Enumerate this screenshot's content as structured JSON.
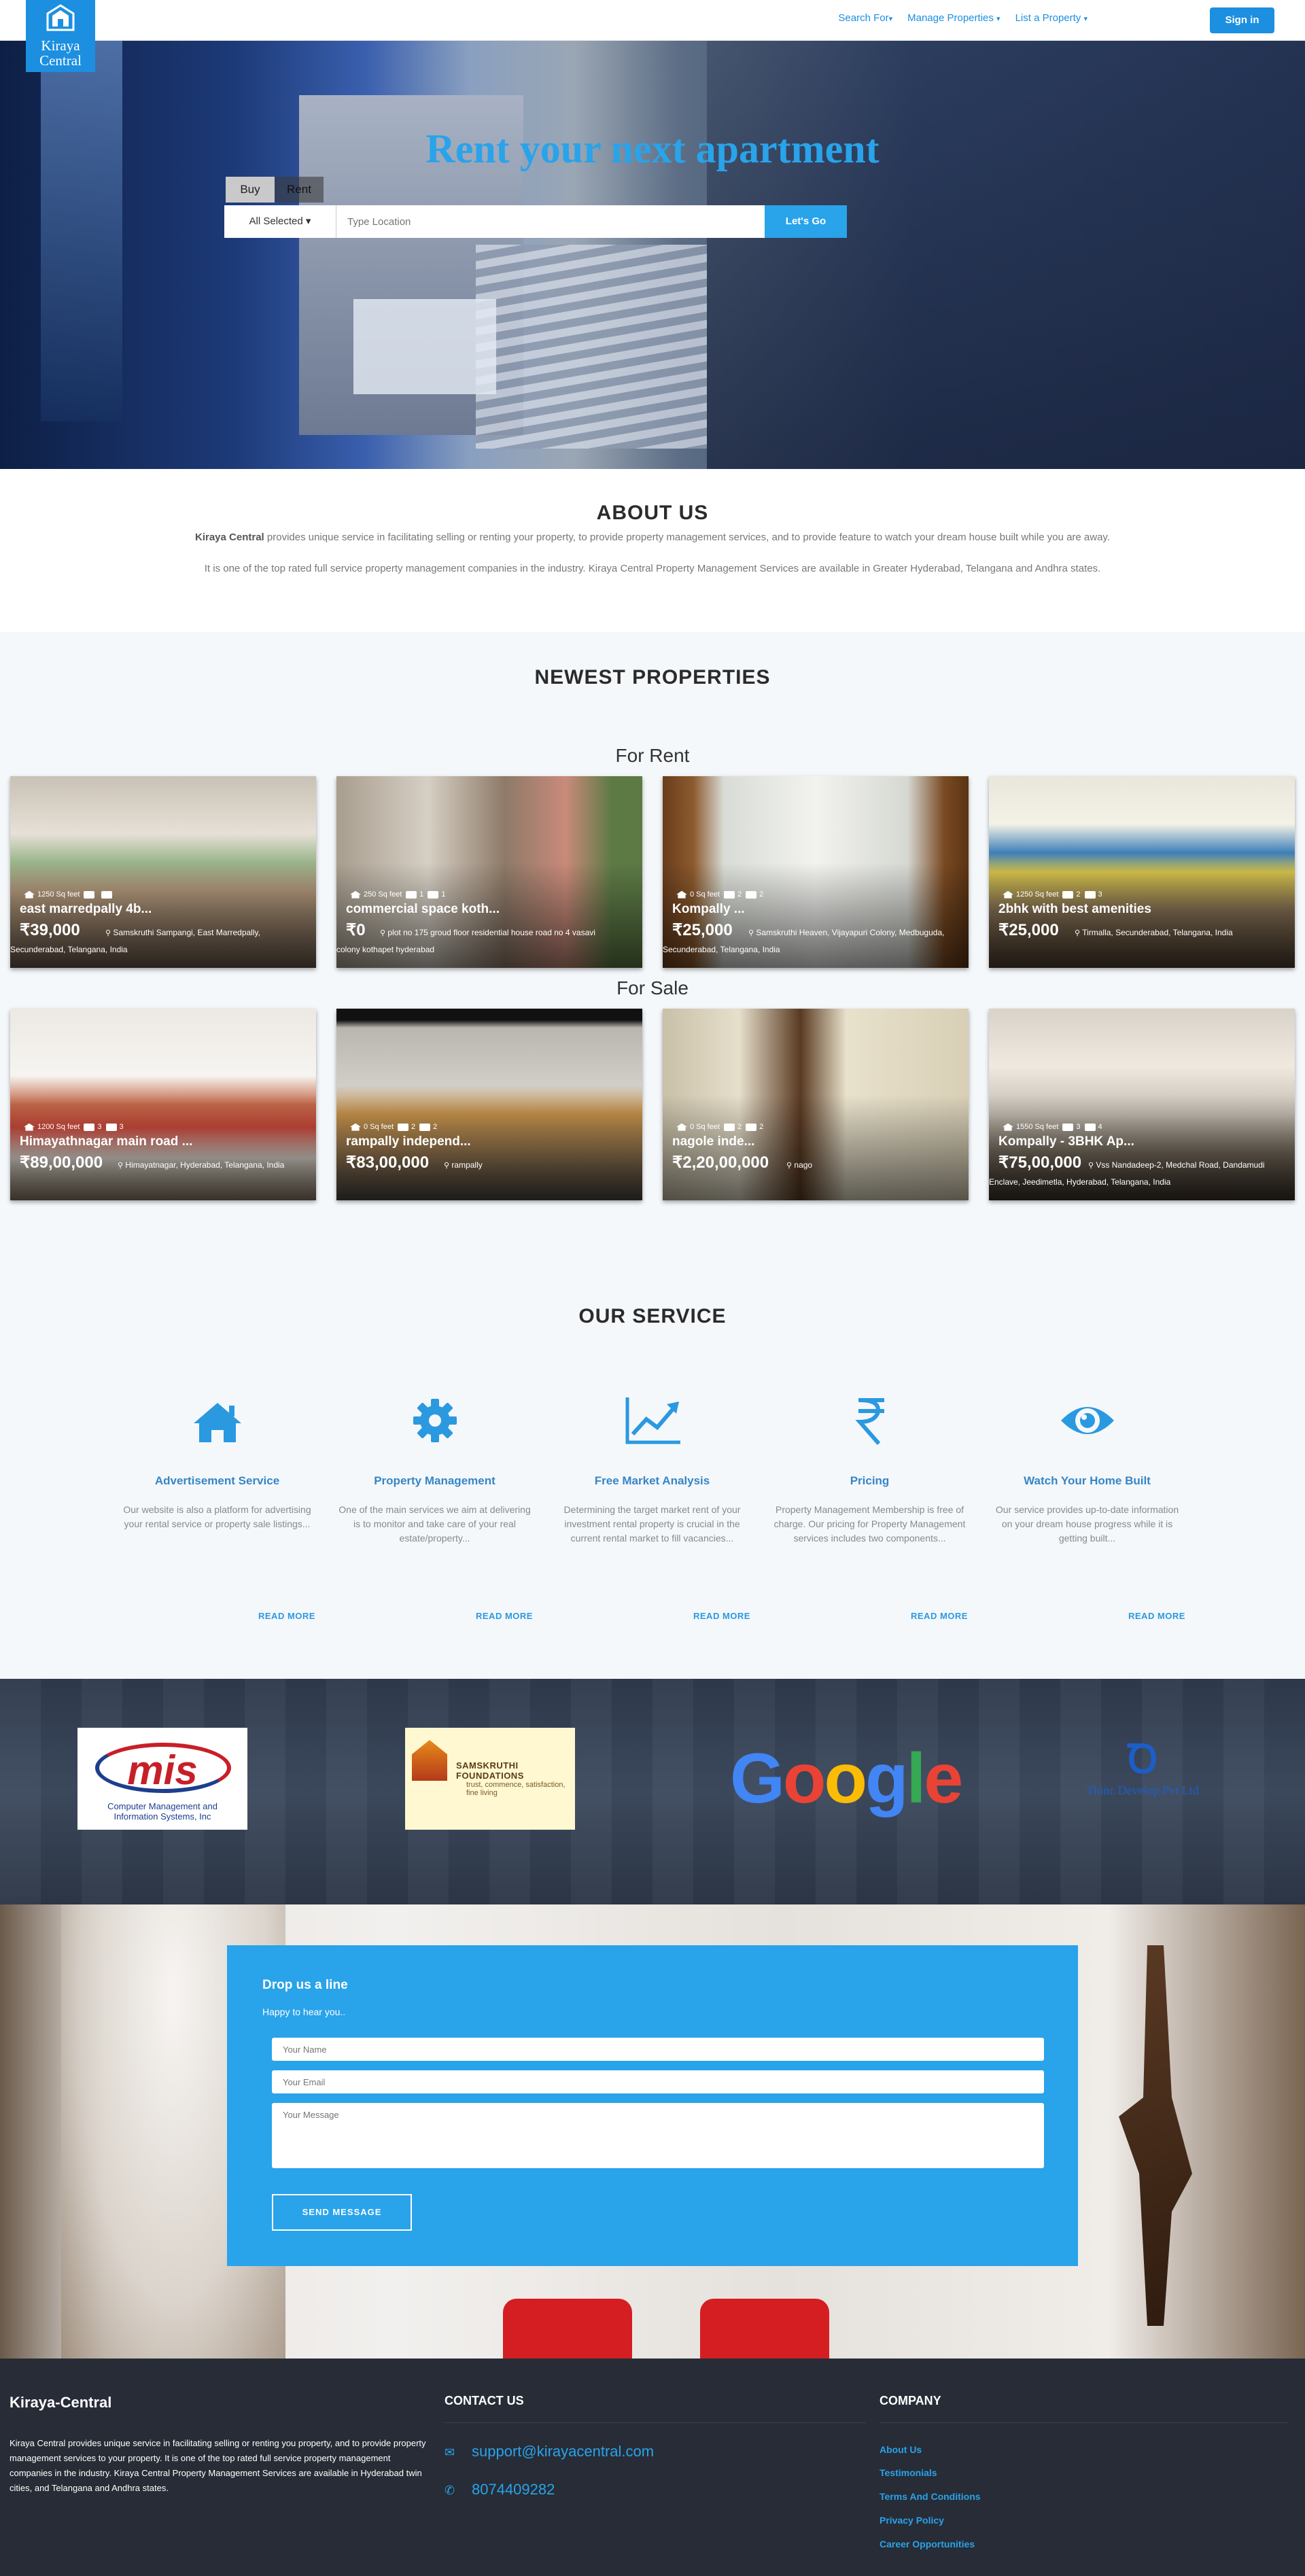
{
  "navbar": {
    "logo_text_line1": "Kiraya",
    "logo_text_line2": "Central",
    "links": [
      {
        "label": "Search For",
        "caret": "▾"
      },
      {
        "label": "Manage Properties",
        "caret": "▾"
      },
      {
        "label": "List a Property",
        "caret": "▾"
      }
    ],
    "signin_label": "Sign in"
  },
  "hero": {
    "title": "Rent your next apartment",
    "tab_buy": "Buy",
    "tab_rent": "Rent",
    "select_label": "All Selected",
    "select_caret": "▾",
    "search_placeholder": "Type Location",
    "search_button": "Let's Go"
  },
  "about": {
    "title": "ABOUT US",
    "brand": "Kiraya Central",
    "paragraph1_rest": " provides unique service in facilitating selling or renting your property, to provide property management services, and to provide feature to watch your dream house built while you are away.",
    "paragraph2": "It is one of the top rated full service property management companies in the industry. Kiraya Central Property Management Services are available in Greater Hyderabad, Telangana and Andhra states."
  },
  "newest": {
    "title": "NEWEST PROPERTIES",
    "rent_title": "For Rent",
    "sale_title": "For Sale",
    "rent": [
      {
        "area": "1250 Sq feet",
        "beds": "",
        "baths": "",
        "name": "east marredpally 4b...",
        "price": "₹39,000",
        "loc_line1": "Samskruthi Sampangi, East Marredpally,",
        "loc_line2": "Secunderabad, Telangana, India"
      },
      {
        "area": "250 Sq feet",
        "beds": "1",
        "baths": "1",
        "name": "commercial space koth...",
        "price": "₹0",
        "loc_line1": "plot no 175 groud floor residential house road no 4 vasavi",
        "loc_line2": "colony kothapet hyderabad"
      },
      {
        "area": "0 Sq feet",
        "beds": "2",
        "baths": "2",
        "name": "Kompally ...",
        "price": "₹25,000",
        "loc_line1": "Samskruthi Heaven, Vijayapuri Colony, Medbuguda,",
        "loc_line2": "Secunderabad, Telangana, India"
      },
      {
        "area": "1250 Sq feet",
        "beds": "2",
        "baths": "3",
        "name": "2bhk with best amenities",
        "price": "₹25,000",
        "loc_line1": "Tirmalla, Secunderabad, Telangana, India",
        "loc_line2": ""
      }
    ],
    "sale": [
      {
        "area": "1200 Sq feet",
        "beds": "3",
        "baths": "3",
        "name": "Himayathnagar main road ...",
        "price": "₹89,00,000",
        "loc_line1": "Himayatnagar, Hyderabad, Telangana, India",
        "loc_line2": ""
      },
      {
        "area": "0 Sq feet",
        "beds": "2",
        "baths": "2",
        "name": "rampally independ...",
        "price": "₹83,00,000",
        "loc_line1": "rampally",
        "loc_line2": ""
      },
      {
        "area": "0 Sq feet",
        "beds": "2",
        "baths": "2",
        "name": "nagole inde...",
        "price": "₹2,20,00,000",
        "loc_line1": "nago",
        "loc_line2": ""
      },
      {
        "area": "1550 Sq feet",
        "beds": "3",
        "baths": "4",
        "name": "Kompally - 3BHK Ap...",
        "price": "₹75,00,000",
        "loc_line1": "Vss Nandadeep-2, Medchal Road, Dandamudi",
        "loc_line2": "Enclave, Jeedimetla, Hyderabad, Telangana, India"
      }
    ]
  },
  "service": {
    "title": "OUR SERVICE",
    "items": [
      {
        "icon": "home-icon",
        "title": "Advertisement Service",
        "desc": "Our website is also a platform for advertising your rental service or property sale listings..."
      },
      {
        "icon": "gear-icon",
        "title": "Property Management",
        "desc": "One of the main services we aim at delivering is to monitor and take care of your real estate/property..."
      },
      {
        "icon": "chart-line-icon",
        "title": "Free Market Analysis",
        "desc": "Determining the target market rent of your investment rental property is crucial in the current rental market to fill vacancies..."
      },
      {
        "icon": "rupee-icon",
        "title": "Pricing",
        "desc": "Property Management Membership is free of charge. Our pricing for Property Management services includes two components..."
      },
      {
        "icon": "eye-icon",
        "title": "Watch Your Home Built",
        "desc": "Our service provides up-to-date information on your dream house progress while it is getting built..."
      }
    ],
    "read_more": "READ MORE"
  },
  "clients": {
    "mis_big": "mis",
    "mis_caption_line1": "Computer Management and",
    "mis_caption_line2": "Information Systems, Inc",
    "sams_name": "SAMSKRUTHI FOUNDATIONS",
    "sams_sub": "trust, commence, satisfaction, fine living",
    "google_word": "Google",
    "google_colors": [
      "#4285f4",
      "#ea4335",
      "#fbbc05",
      "#4285f4",
      "#34a853",
      "#ea4335"
    ],
    "thinc_glyph": "Ꝺ",
    "thinc_label": "Thinc Develop Pvt Ltd"
  },
  "contact": {
    "title": "Drop us a line",
    "subtitle": "Happy to hear you..",
    "name_placeholder": "Your Name",
    "email_placeholder": "Your Email",
    "message_placeholder": "Your Message",
    "send_label": "SEND MESSAGE"
  },
  "footer": {
    "brand": "Kiraya-Central",
    "about": "Kiraya Central provides unique service in facilitating selling or renting you property, and to provide property management services to your property. It is one of the top rated full service property management companies in the industry. Kiraya Central Property Management Services are available in Hyderabad twin cities, and Telangana and Andhra states.",
    "contact_title": "CONTACT US",
    "email": "support@kirayacentral.com",
    "phone": "8074409282",
    "company_title": "COMPANY",
    "company_links": [
      "About Us",
      "Testimonials",
      "Terms And Conditions",
      "Privacy Policy",
      "Career Opportunities"
    ]
  },
  "colors": {
    "accent": "#29a3ea",
    "brand_blue": "#1c8fe0",
    "footer_bg": "#272c36"
  }
}
